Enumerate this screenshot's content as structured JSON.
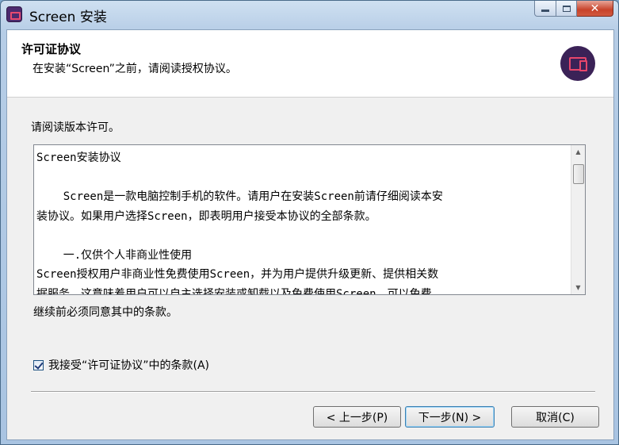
{
  "window": {
    "title": "Screen 安装",
    "app_icon": "screen-app-icon",
    "close_glyph": "✕"
  },
  "header": {
    "title": "许可证协议",
    "subtitle": "在安装“Screen”之前，请阅读授权协议。",
    "logo_icon": "screen-logo-icon"
  },
  "body": {
    "section_label": "请阅读版本许可。",
    "license_lines": [
      "Screen安装协议",
      "",
      "    Screen是一款电脑控制手机的软件。请用户在安装Screen前请仔细阅读本安",
      "装协议。如果用户选择Screen，即表明用户接受本协议的全部条款。",
      "",
      "    一.仅供个人非商业性使用",
      "Screen授权用户非商业性免费使用Screen，并为用户提供升级更新、提供相关数",
      "据服务。这意味着用户可以自主选择安装或卸载以及免费使用Screen，可以免费"
    ],
    "continue_text": "继续前必须同意其中的条款。",
    "accept_label": "我接受“许可证协议”中的条款(A)",
    "accept_checked": true
  },
  "buttons": {
    "back": "< 上一步(P)",
    "next": "下一步(N) >",
    "cancel": "取消(C)"
  }
}
